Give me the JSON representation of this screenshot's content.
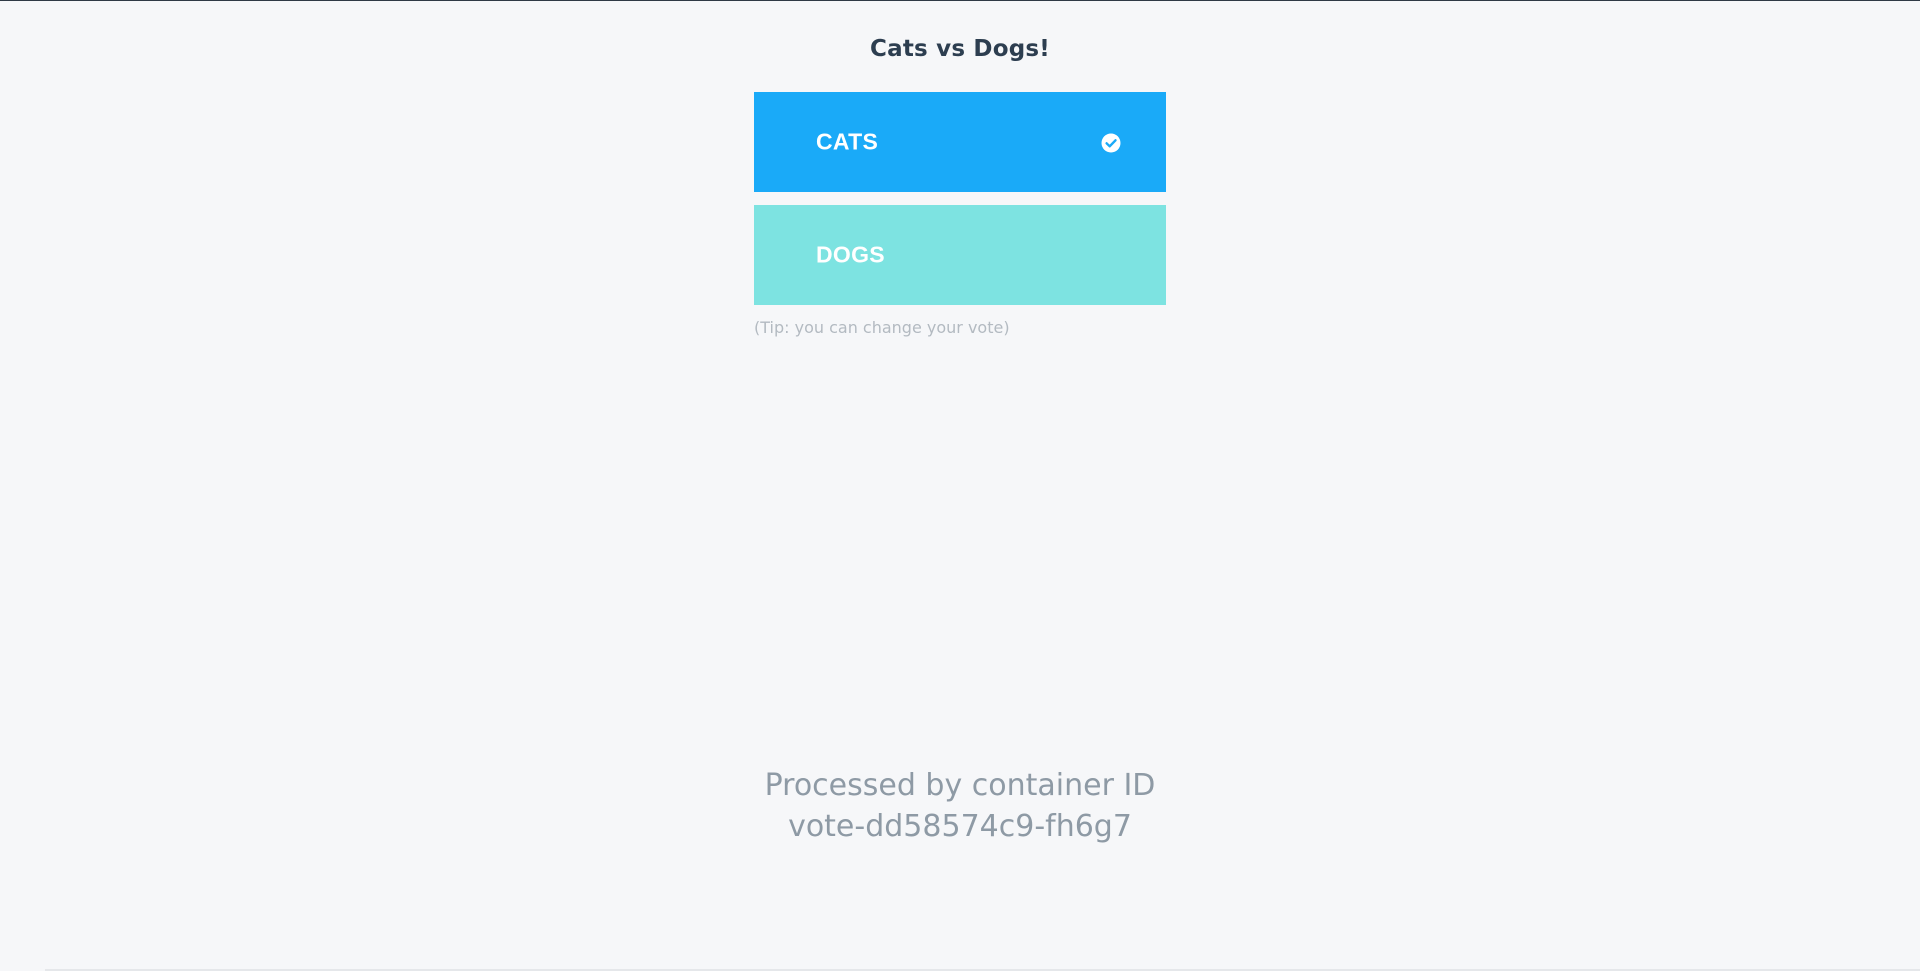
{
  "header": {
    "title": "Cats vs Dogs!"
  },
  "options": [
    {
      "label": "CATS",
      "selected": true,
      "color": "#1aaaf8"
    },
    {
      "label": "DOGS",
      "selected": false,
      "color": "#7de3e1"
    }
  ],
  "tip": "(Tip: you can change your vote)",
  "footer": {
    "line1": "Processed by container ID",
    "line2": "vote-dd58574c9-fh6g7"
  },
  "colors": {
    "background": "#f6f7f9",
    "title": "#2d3e50",
    "footer_text": "#8e9aa5"
  }
}
